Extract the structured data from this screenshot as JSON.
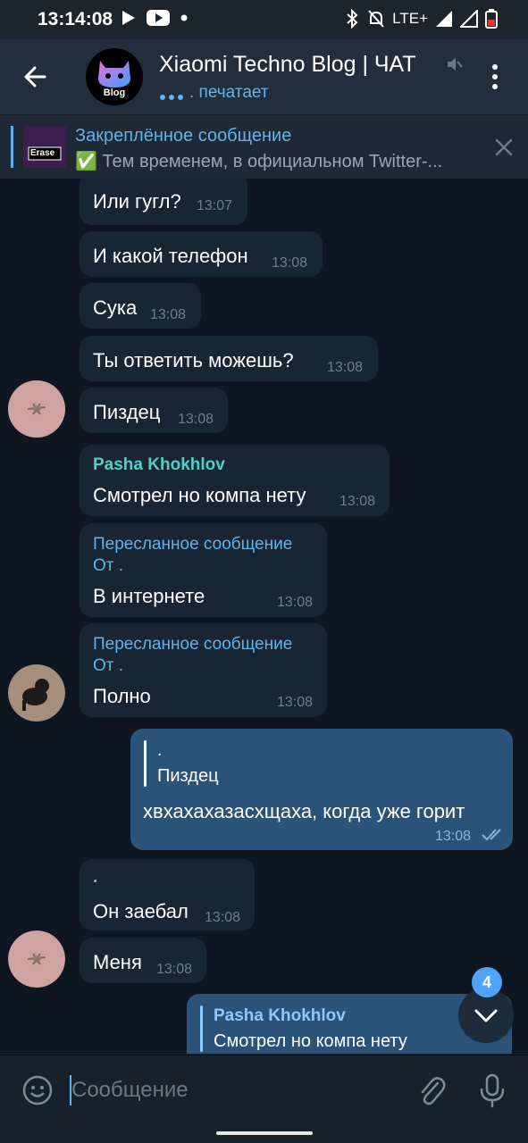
{
  "status": {
    "time": "13:14:08",
    "network": "LTE+"
  },
  "header": {
    "title": "Xiaomi Techno Blog | ЧАТ",
    "avatar_text": "Blog",
    "typing": ". печатает"
  },
  "pinned": {
    "title": "Закреплённое сообщение",
    "text": "✅ Тем временем, в официальном Twitter-...",
    "thumb_label": "Erase"
  },
  "messages": [
    {
      "text": "Или гугл?",
      "time": "13:07"
    },
    {
      "text": "И какой телефон",
      "time": "13:08"
    },
    {
      "text": "Сука",
      "time": "13:08"
    },
    {
      "text": "Ты ответить можешь?",
      "time": "13:08"
    },
    {
      "text": "Пиздец",
      "time": "13:08"
    },
    {
      "sender": "Pasha Khokhlov",
      "text": "Смотрел но компа нету",
      "time": "13:08"
    },
    {
      "forward_label": "Пересланное сообщение",
      "forward_from": "От .",
      "text": "В интернете",
      "time": "13:08"
    },
    {
      "forward_label": "Пересланное сообщение",
      "forward_from": "От .",
      "text": "Полно",
      "time": "13:08"
    },
    {
      "reply_name": ".",
      "reply_text": "Пиздец",
      "text": "хвхахахазасхщаха, когда уже горит",
      "time": "13:08"
    },
    {
      "reply_name": ".",
      "text": "Он заебал",
      "time": "13:08"
    },
    {
      "text": "Меня",
      "time": "13:08"
    },
    {
      "reply_name": "Pasha Khokhlov",
      "reply_text": "Смотрел но компа нету"
    }
  ],
  "scroll": {
    "unread_count": "4"
  },
  "composer": {
    "placeholder": "Сообщение"
  },
  "colors": {
    "accent": "#5fb3ee",
    "sender": "#4fd1c5",
    "out_bubble": "#2b5278",
    "in_bubble": "#182533",
    "background": "#0e1621"
  }
}
